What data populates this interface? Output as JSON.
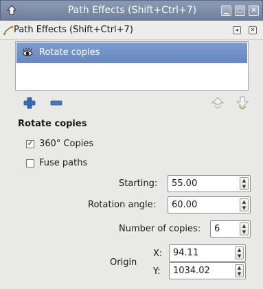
{
  "window": {
    "title": "Path Effects  (Shift+Ctrl+7)"
  },
  "dock": {
    "title": "Path Effects  (Shift+Ctrl+7)"
  },
  "effects_list": [
    {
      "name": "Rotate copies",
      "visible": true,
      "selected": true
    }
  ],
  "params": {
    "heading": "Rotate copies",
    "copies_360": {
      "label": "360° Copies",
      "checked": true,
      "mark": "✓"
    },
    "fuse_paths": {
      "label": "Fuse paths",
      "checked": false,
      "mark": ""
    },
    "starting": {
      "label": "Starting:",
      "value": "55.00"
    },
    "rotation_angle": {
      "label": "Rotation angle:",
      "value": "60.00"
    },
    "number_of_copies": {
      "label": "Number of copies:",
      "value": "6"
    },
    "origin": {
      "label": "Origin",
      "x": {
        "label": "X:",
        "value": "94.11"
      },
      "y": {
        "label": "Y:",
        "value": "1034.02"
      }
    }
  },
  "colors": {
    "titlebar": "#7888a6",
    "selection": "#6f8dc7",
    "add_icon": "#3a6fb8",
    "remove_icon": "#4d78b8"
  }
}
